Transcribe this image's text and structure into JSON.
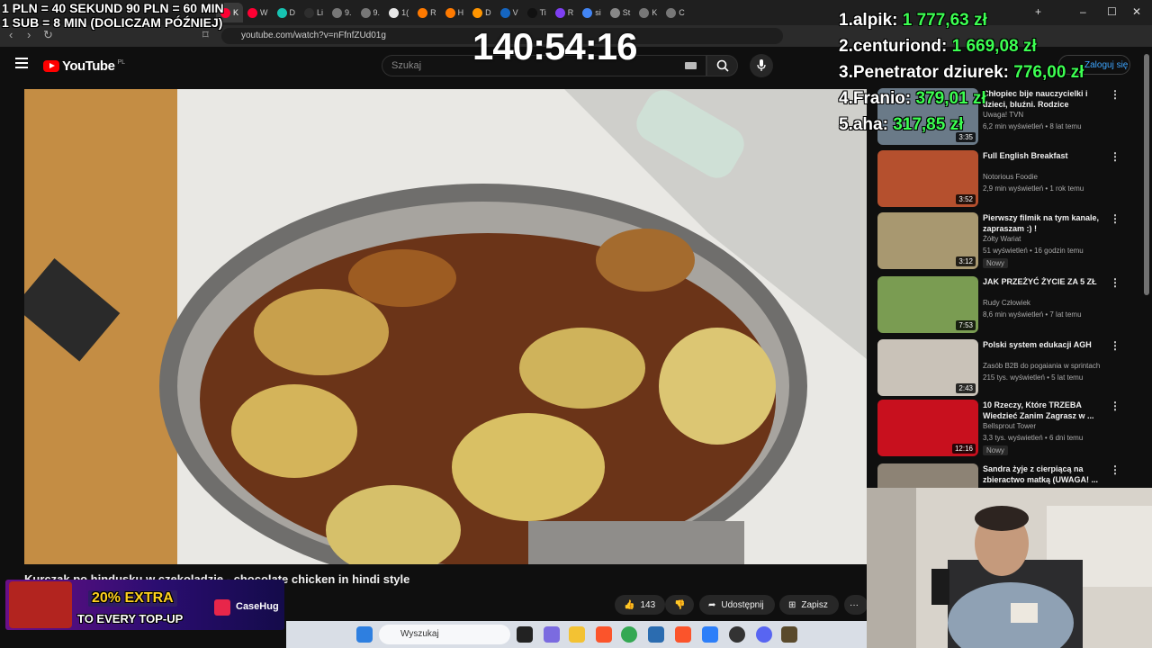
{
  "browser": {
    "tabs": [
      {
        "label": "K",
        "color": "#ff0033"
      },
      {
        "label": "W",
        "color": "#ff0033"
      },
      {
        "label": "D",
        "color": "#17c3b2"
      },
      {
        "label": "Li",
        "color": "#2e2e2e"
      },
      {
        "label": "9.",
        "color": "#777777"
      },
      {
        "label": "9.",
        "color": "#777777"
      },
      {
        "label": "1(",
        "color": "#e8e8e8"
      },
      {
        "label": "R",
        "color": "#ff7a00"
      },
      {
        "label": "H",
        "color": "#ff7a00"
      },
      {
        "label": "D",
        "color": "#ff9500"
      },
      {
        "label": "V",
        "color": "#1565c0"
      },
      {
        "label": "Ti",
        "color": "#111111"
      },
      {
        "label": "R",
        "color": "#7e3ff2"
      },
      {
        "label": "si",
        "color": "#4285f4"
      },
      {
        "label": "St",
        "color": "#888888"
      },
      {
        "label": "K",
        "color": "#777777"
      },
      {
        "label": "C",
        "color": "#777777"
      }
    ],
    "url": "youtube.com/watch?v=nFfnfZUd01g",
    "win_minimize": "–",
    "win_maximize": "☐",
    "win_close": "✕",
    "new_tab": "+"
  },
  "youtube": {
    "logo_word": "YouTube",
    "region": "PL",
    "search_placeholder": "Szukaj",
    "signin_label": "Zaloguj się",
    "video_title": "Kurczak po hindusku w czekoladzie - chocolate chicken in hindi style",
    "likes": "143",
    "share_label": "Udostępnij",
    "save_label": "Zapisz",
    "more_label": "···"
  },
  "recommendations": [
    {
      "title": "Chłopiec bije nauczycielki i dzieci, bluźni. Rodzice uczniów...",
      "channel": "Uwaga! TVN",
      "meta": "6,2 min wyświetleń • 8 lat temu",
      "duration": "3:35",
      "badge": "",
      "thumb_color": "#6a7a88"
    },
    {
      "title": "Full English Breakfast",
      "channel": "Notorious Foodie",
      "meta": "2,9 min wyświetleń • 1 rok temu",
      "duration": "3:52",
      "badge": "",
      "thumb_color": "#b5502e"
    },
    {
      "title": "Pierwszy filmik na tym kanale, zapraszam :) !",
      "channel": "Żółty Wariat",
      "meta": "51 wyświetleń • 16 godzin temu",
      "duration": "3:12",
      "badge": "Nowy",
      "thumb_color": "#a89870"
    },
    {
      "title": "JAK PRZEŻYĆ ŻYCIE ZA 5 ZŁ",
      "channel": "Rudy Człowiek",
      "meta": "8,6 min wyświetleń • 7 lat temu",
      "duration": "7:53",
      "badge": "",
      "thumb_color": "#7a9c52"
    },
    {
      "title": "Polski system edukacji AGH",
      "channel": "Zasób B2B do pogaiania w sprintach",
      "meta": "215 tys. wyświetleń • 5 lat temu",
      "duration": "2:43",
      "badge": "",
      "thumb_color": "#c9c2b8"
    },
    {
      "title": "10 Rzeczy, Które TRZEBA Wiedzieć Zanim Zagrasz w ...",
      "channel": "Bellsprout Tower",
      "meta": "3,3 tys. wyświetleń • 6 dni temu",
      "duration": "12:16",
      "badge": "Nowy",
      "thumb_color": "#c8101e"
    },
    {
      "title": "Sandra żyje z cierpiącą na zbieractwo matką (UWAGA! ...",
      "channel": "",
      "meta": "",
      "duration": "",
      "badge": "",
      "thumb_color": "#8d8375"
    }
  ],
  "overlay": {
    "timer": "140:54:16",
    "rate_line1": "1 PLN =  40 SEKUND 90 PLN = 60 MIN",
    "rate_line2": "1 SUB = 8 MIN (DOLICZAM PÓŹNIEJ)",
    "leaderboard": [
      {
        "name": "1.alpik:",
        "amount": "1 777,63 zł"
      },
      {
        "name": "2.centuriond:",
        "amount": "1 669,08 zł"
      },
      {
        "name": "3.Penetrator dziurek:",
        "amount": "776,00 zł"
      },
      {
        "name": "4.Franio:",
        "amount": "379,01 zł"
      },
      {
        "name": "5.aha:",
        "amount": "317,85 zł"
      }
    ],
    "promo_line1": "20% EXTRA",
    "promo_line2": "TO EVERY TOP-UP",
    "promo_brand": "CaseHug",
    "accent_green": "#3dff52"
  },
  "taskbar": {
    "search_placeholder": "Wyszukaj"
  }
}
